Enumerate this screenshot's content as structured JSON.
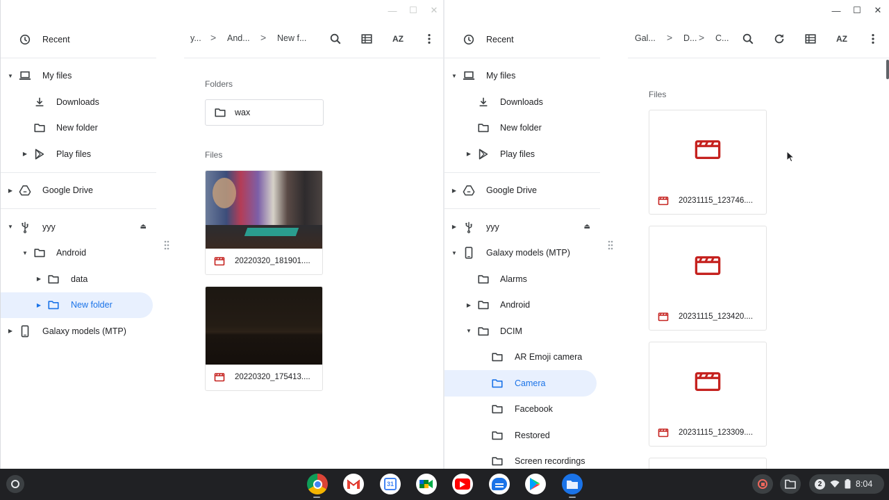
{
  "left_window": {
    "sidebar": {
      "recent": "Recent",
      "my_files": "My files",
      "downloads": "Downloads",
      "new_folder": "New folder",
      "play_files": "Play files",
      "google_drive": "Google Drive",
      "yyy": "yyy",
      "android": "Android",
      "data": "data",
      "new_folder_selected": "New folder",
      "galaxy": "Galaxy models (MTP)"
    },
    "breadcrumb": [
      "y...",
      "And...",
      "New f..."
    ],
    "sort_label": "AZ",
    "folders_header": "Folders",
    "folders": [
      "wax"
    ],
    "files_header": "Files",
    "files": [
      "20220320_181901....",
      "20220320_175413...."
    ]
  },
  "right_window": {
    "sidebar": {
      "recent": "Recent",
      "my_files": "My files",
      "downloads": "Downloads",
      "new_folder": "New folder",
      "play_files": "Play files",
      "google_drive": "Google Drive",
      "yyy": "yyy",
      "galaxy": "Galaxy models (MTP)",
      "alarms": "Alarms",
      "android": "Android",
      "dcim": "DCIM",
      "ar_emoji": "AR Emoji camera",
      "camera": "Camera",
      "facebook": "Facebook",
      "restored": "Restored",
      "screen_recordings": "Screen recordings"
    },
    "breadcrumb": [
      "Gal...",
      "D...",
      "C..."
    ],
    "sort_label": "AZ",
    "files_header": "Files",
    "files": [
      "20231115_123746....",
      "20231115_123420....",
      "20231115_123309...."
    ]
  },
  "shelf": {
    "apps": [
      "chrome-icon",
      "gmail-icon",
      "calendar-icon",
      "meet-icon",
      "youtube-icon",
      "messages-icon",
      "play-store-icon",
      "files-icon"
    ],
    "notification_count": "2",
    "time": "8:04"
  },
  "colors": {
    "accent": "#1a73e8",
    "selection": "#e8f0fe",
    "video_icon": "#c5221f",
    "shelf": "#202124"
  }
}
